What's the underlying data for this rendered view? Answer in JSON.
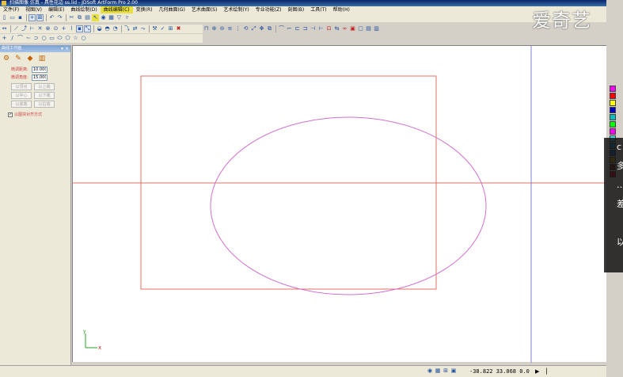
{
  "window": {
    "title": "扫描图像 仿真 - 具性花边 ss.lid - JDSoft ArtForm Pro 2.00"
  },
  "menubar": {
    "items": [
      {
        "label": "文件(F)"
      },
      {
        "label": "视图(V)"
      },
      {
        "label": "编辑(E)"
      },
      {
        "label": "曲线绘制(D)"
      },
      {
        "label": "曲线编辑(C)",
        "active": true
      },
      {
        "label": "变换(R)"
      },
      {
        "label": "几何曲面(G)"
      },
      {
        "label": "艺术曲面(S)"
      },
      {
        "label": "艺术绘制(Y)"
      },
      {
        "label": "专业功能(Z)"
      },
      {
        "label": "刻图(B)"
      },
      {
        "label": "工具(T)"
      },
      {
        "label": "帮助(H)"
      }
    ]
  },
  "left_panel": {
    "header": "曲线工作面",
    "header_controls": "▾ ×",
    "fields": [
      {
        "label": "微调距离:",
        "value": "10.000"
      },
      {
        "label": "微调角度:",
        "value": "15.000"
      }
    ],
    "buttons": [
      "以顶点",
      "以上端",
      "以中心",
      "以下端",
      "以底端",
      "以右端"
    ],
    "checkbox": {
      "label": "以图块对齐方式",
      "checked": "✓"
    }
  },
  "canvas": {
    "colors": {
      "rectangle": "#e07060",
      "ellipse": "#d070d0",
      "horizontal_line": "#e07060",
      "vertical_line": "#8080d8",
      "axis": "#20a020",
      "axis_x_label": "#d02020"
    },
    "axis_labels": {
      "x": "x",
      "y": "y"
    }
  },
  "palette": {
    "colors": [
      "#ff00ff",
      "#ff0000",
      "#ffff00",
      "#0000c0",
      "#00c0c0",
      "#00ff00",
      "#ff00ff",
      "#40e0e0",
      "#00a0e0",
      "#0060c0",
      "#c0a000",
      "#802000",
      "#ff0000"
    ]
  },
  "overlay": {
    "chars": [
      "c",
      "多",
      "…",
      "差",
      "",
      "以"
    ]
  },
  "watermark": {
    "text": "爱奇艺"
  },
  "statusbar": {
    "coordinates": "-38.822  33.068  0.0"
  }
}
